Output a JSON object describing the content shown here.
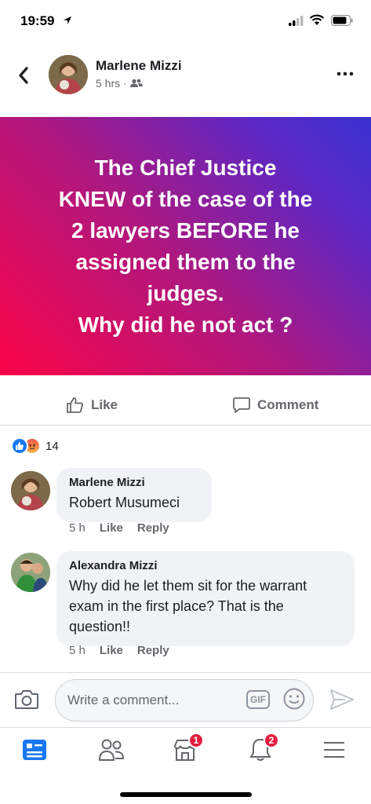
{
  "status_bar": {
    "time": "19:59"
  },
  "post": {
    "author": "Marlene Mizzi",
    "time": "5 hrs",
    "separator": "·",
    "banner_text": "The Chief Justice\nKNEW of the case of the\n2 lawyers BEFORE  he\nassigned them to the\njudges.\nWhy did he not act ?",
    "background_gradient": [
      "#fb0347",
      "#3a32d0"
    ]
  },
  "actions": {
    "like_label": "Like",
    "comment_label": "Comment"
  },
  "reactions": {
    "count": "14"
  },
  "comments": [
    {
      "author": "Marlene Mizzi",
      "text": "Robert Musumeci",
      "time": "5 h",
      "like_label": "Like",
      "reply_label": "Reply"
    },
    {
      "author": "Alexandra Mizzi",
      "text": "Why did he let them sit for the warrant exam in the first place? That is the question!!",
      "time": "5 h",
      "like_label": "Like",
      "reply_label": "Reply"
    }
  ],
  "composer": {
    "placeholder": "Write a comment...",
    "gif_label": "GIF"
  },
  "tab_bar": {
    "items": [
      {
        "icon": "news-feed-icon",
        "active": true
      },
      {
        "icon": "friends-icon"
      },
      {
        "icon": "marketplace-icon",
        "badge": "1"
      },
      {
        "icon": "notifications-icon",
        "badge": "2"
      },
      {
        "icon": "menu-icon"
      }
    ]
  },
  "colors": {
    "accent": "#1877f2",
    "badge": "#e41e3f",
    "muted": "#65676b"
  }
}
